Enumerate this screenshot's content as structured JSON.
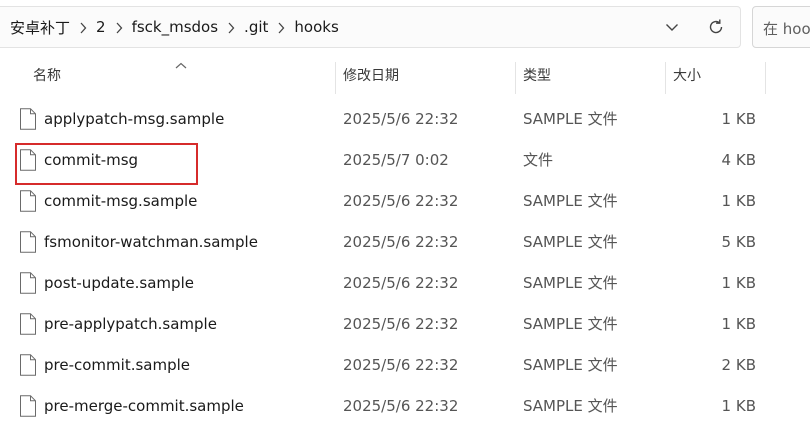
{
  "breadcrumb": [
    "安卓补丁",
    "2",
    "fsck_msdos",
    ".git",
    "hooks"
  ],
  "search": {
    "placeholder": "在 hooks"
  },
  "columns": {
    "name": "名称",
    "modified": "修改日期",
    "type": "类型",
    "size": "大小"
  },
  "files": [
    {
      "name": "applypatch-msg.sample",
      "modified": "2025/5/6 22:32",
      "type": "SAMPLE 文件",
      "size": "1 KB"
    },
    {
      "name": "commit-msg",
      "modified": "2025/5/7 0:02",
      "type": "文件",
      "size": "4 KB",
      "highlighted": true
    },
    {
      "name": "commit-msg.sample",
      "modified": "2025/5/6 22:32",
      "type": "SAMPLE 文件",
      "size": "1 KB"
    },
    {
      "name": "fsmonitor-watchman.sample",
      "modified": "2025/5/6 22:32",
      "type": "SAMPLE 文件",
      "size": "5 KB"
    },
    {
      "name": "post-update.sample",
      "modified": "2025/5/6 22:32",
      "type": "SAMPLE 文件",
      "size": "1 KB"
    },
    {
      "name": "pre-applypatch.sample",
      "modified": "2025/5/6 22:32",
      "type": "SAMPLE 文件",
      "size": "1 KB"
    },
    {
      "name": "pre-commit.sample",
      "modified": "2025/5/6 22:32",
      "type": "SAMPLE 文件",
      "size": "2 KB"
    },
    {
      "name": "pre-merge-commit.sample",
      "modified": "2025/5/6 22:32",
      "type": "SAMPLE 文件",
      "size": "1 KB"
    }
  ],
  "colors": {
    "highlight": "#d62b2b",
    "border": "#e3e3e3"
  },
  "icons": {
    "sort": "chevron-up-icon",
    "file": "file-icon",
    "dropdown": "chevron-down-icon",
    "refresh": "refresh-icon",
    "separator": "chevron-right-icon"
  }
}
